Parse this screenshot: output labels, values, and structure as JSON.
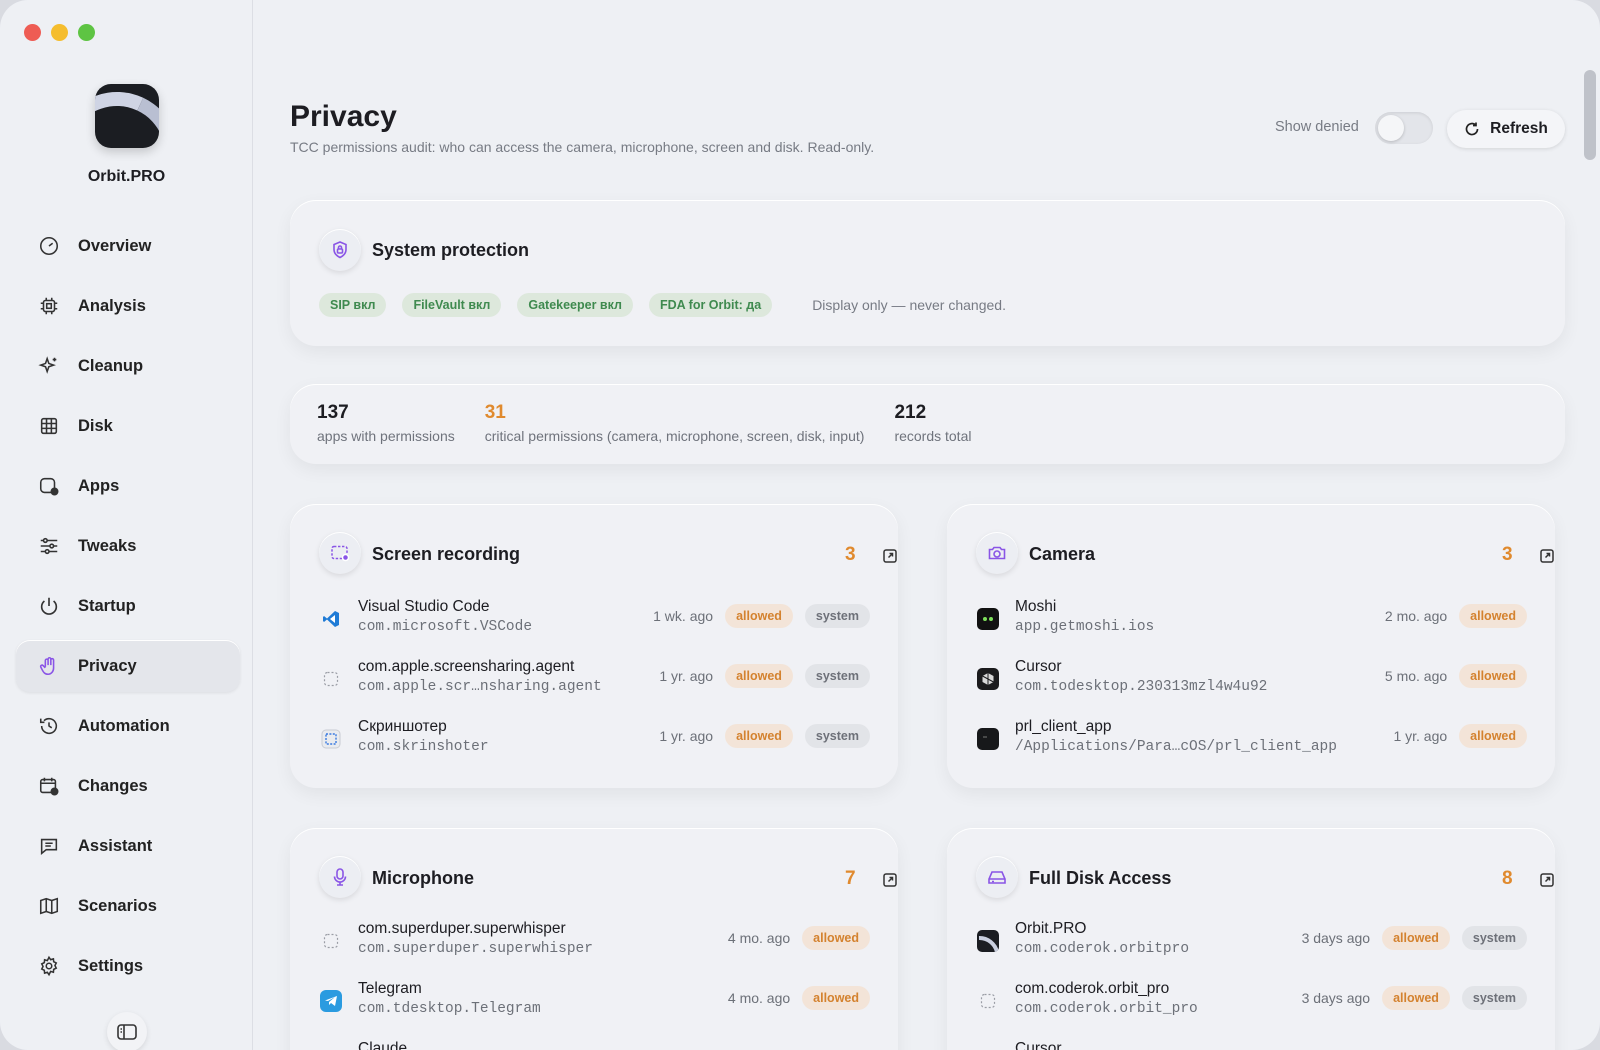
{
  "window": {
    "traffic": [
      "#ee5c54",
      "#f5bd2e",
      "#5ec443"
    ]
  },
  "sidebar": {
    "app_name": "Orbit.PRO",
    "items": [
      {
        "label": "Overview",
        "icon": "gauge-icon",
        "active": false
      },
      {
        "label": "Analysis",
        "icon": "chip-icon",
        "active": false
      },
      {
        "label": "Cleanup",
        "icon": "sparkle-icon",
        "active": false
      },
      {
        "label": "Disk",
        "icon": "grid-icon",
        "active": false
      },
      {
        "label": "Apps",
        "icon": "app-icon",
        "active": false
      },
      {
        "label": "Tweaks",
        "icon": "sliders-icon",
        "active": false
      },
      {
        "label": "Startup",
        "icon": "power-icon",
        "active": false
      },
      {
        "label": "Privacy",
        "icon": "hand-icon",
        "active": true
      },
      {
        "label": "Automation",
        "icon": "history-icon",
        "active": false
      },
      {
        "label": "Changes",
        "icon": "calendar-icon",
        "active": false
      },
      {
        "label": "Assistant",
        "icon": "chat-icon",
        "active": false
      },
      {
        "label": "Scenarios",
        "icon": "map-icon",
        "active": false
      },
      {
        "label": "Settings",
        "icon": "gear-icon",
        "active": false
      }
    ]
  },
  "header": {
    "title": "Privacy",
    "subtitle": "TCC permissions audit: who can access the camera, microphone, screen and disk. Read-only.",
    "show_denied_label": "Show denied",
    "refresh_label": "Refresh"
  },
  "protection": {
    "title": "System protection",
    "chips": [
      "SIP вкл",
      "FileVault вкл",
      "Gatekeeper вкл",
      "FDA for Orbit: да"
    ],
    "note": "Display only — never changed."
  },
  "stats": [
    {
      "num": "137",
      "label": "apps with permissions",
      "accent": false
    },
    {
      "num": "31",
      "label": "critical permissions (camera, microphone, screen, disk, input)",
      "accent": true
    },
    {
      "num": "212",
      "label": "records total",
      "accent": false
    }
  ],
  "accent_color": "#e08a2e",
  "groups": {
    "screen": {
      "title": "Screen recording",
      "count": "3",
      "rows": [
        {
          "name": "Visual Studio Code",
          "bid": "com.microsoft.VSCode",
          "time": "1 wk. ago",
          "status": "allowed",
          "tag": "system"
        },
        {
          "name": "com.apple.screensharing.agent",
          "bid": "com.apple.scr…nsharing.agent",
          "time": "1 yr. ago",
          "status": "allowed",
          "tag": "system"
        },
        {
          "name": "Скриншотер",
          "bid": "com.skrinshoter",
          "time": "1 yr. ago",
          "status": "allowed",
          "tag": "system"
        }
      ]
    },
    "camera": {
      "title": "Camera",
      "count": "3",
      "rows": [
        {
          "name": "Moshi",
          "bid": "app.getmoshi.ios",
          "time": "2 mo. ago",
          "status": "allowed"
        },
        {
          "name": "Cursor",
          "bid": "com.todesktop.230313mzl4w4u92",
          "time": "5 mo. ago",
          "status": "allowed"
        },
        {
          "name": "prl_client_app",
          "bid": "/Applications/Para…cOS/prl_client_app",
          "time": "1 yr. ago",
          "status": "allowed"
        }
      ]
    },
    "mic": {
      "title": "Microphone",
      "count": "7",
      "rows": [
        {
          "name": "com.superduper.superwhisper",
          "bid": "com.superduper.superwhisper",
          "time": "4 mo. ago",
          "status": "allowed"
        },
        {
          "name": "Telegram",
          "bid": "com.tdesktop.Telegram",
          "time": "4 mo. ago",
          "status": "allowed"
        },
        {
          "name": "Claude"
        }
      ]
    },
    "disk": {
      "title": "Full Disk Access",
      "count": "8",
      "rows": [
        {
          "name": "Orbit.PRO",
          "bid": "com.coderok.orbitpro",
          "time": "3 days ago",
          "status": "allowed",
          "tag": "system"
        },
        {
          "name": "com.coderok.orbit_pro",
          "bid": "com.coderok.orbit_pro",
          "time": "3 days ago",
          "status": "allowed",
          "tag": "system"
        },
        {
          "name": "Cursor"
        }
      ]
    }
  }
}
